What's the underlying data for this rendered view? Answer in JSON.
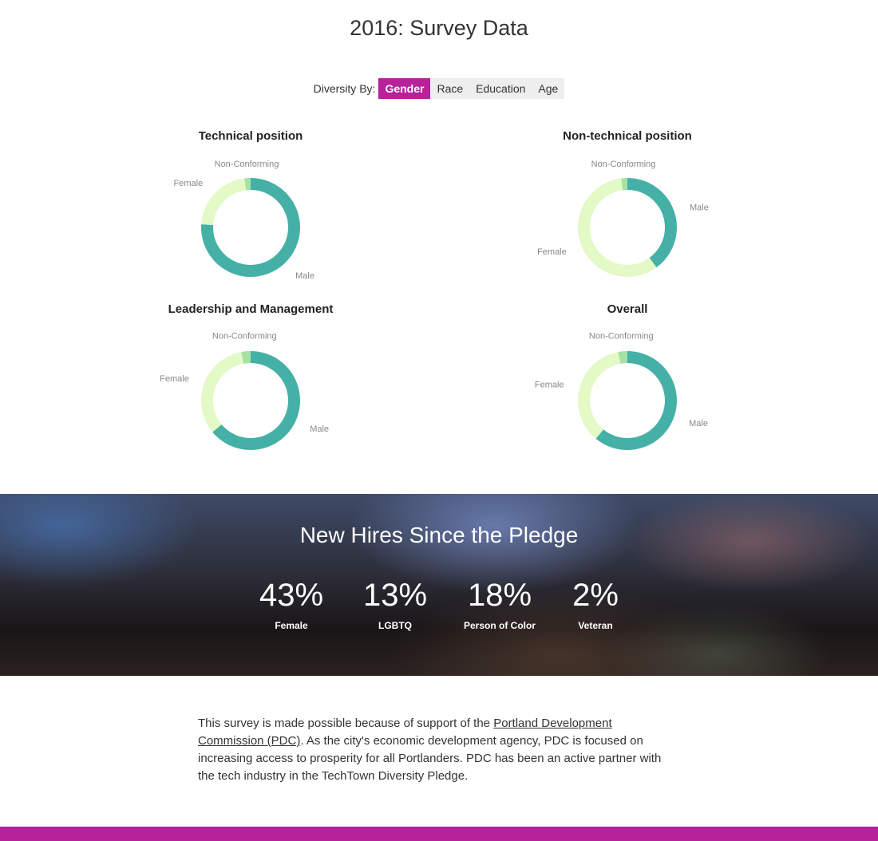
{
  "page": {
    "title": "2016: Survey Data"
  },
  "filter": {
    "label": "Diversity By:",
    "tabs": [
      {
        "label": "Gender",
        "active": true
      },
      {
        "label": "Race",
        "active": false
      },
      {
        "label": "Education",
        "active": false
      },
      {
        "label": "Age",
        "active": false
      }
    ]
  },
  "colors": {
    "accent": "#b5229a",
    "male": "#45b1a6",
    "female": "#e3f9c6",
    "non_conforming": "#a6e2a4"
  },
  "chart_data": [
    {
      "type": "pie",
      "donut": true,
      "title": "Technical position",
      "categories": [
        "Male",
        "Female",
        "Non-Conforming"
      ],
      "values": [
        76,
        22,
        2
      ]
    },
    {
      "type": "pie",
      "donut": true,
      "title": "Non-technical position",
      "categories": [
        "Male",
        "Female",
        "Non-Conforming"
      ],
      "values": [
        40,
        58,
        2
      ]
    },
    {
      "type": "pie",
      "donut": true,
      "title": "Leadership and Management",
      "categories": [
        "Male",
        "Female",
        "Non-Conforming"
      ],
      "values": [
        64,
        33,
        3
      ]
    },
    {
      "type": "pie",
      "donut": true,
      "title": "Overall",
      "categories": [
        "Male",
        "Female",
        "Non-Conforming"
      ],
      "values": [
        61,
        36,
        3
      ]
    }
  ],
  "new_hires": {
    "title": "New Hires Since the Pledge",
    "stats": [
      {
        "value": "43%",
        "label": "Female"
      },
      {
        "value": "13%",
        "label": "LGBTQ"
      },
      {
        "value": "18%",
        "label": "Person of Color"
      },
      {
        "value": "2%",
        "label": "Veteran"
      }
    ]
  },
  "about": {
    "text_before": "This survey is made possible because of support of the ",
    "link_text": "Portland Development Commission (PDC)",
    "text_after": ". As the city's economic development agency, PDC is focused on increasing access to prosperity for all Portlanders. PDC has been an active partner with the tech industry in the TechTown Diversity Pledge."
  }
}
